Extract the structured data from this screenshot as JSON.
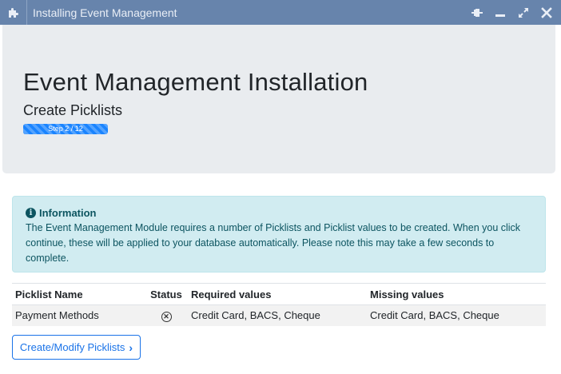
{
  "window": {
    "title": "Installing Event Management",
    "title_bar_color": "#6784ac",
    "icons": [
      "puzzle-icon",
      "pin-icon",
      "minimize-icon",
      "maximize-icon",
      "close-icon"
    ]
  },
  "header": {
    "title": "Event Management Installation",
    "subtitle": "Create Picklists",
    "progress": {
      "label": "Step 2 / 12",
      "current": 2,
      "total": 12,
      "color": "#1a84ff"
    }
  },
  "info": {
    "heading": "Information",
    "text": "The Event Management Module requires a number of Picklists and Picklist values to be created. When you click continue, these will be applied to your database automatically. Please note this may take a few seconds to complete."
  },
  "table": {
    "headers": [
      "Picklist Name",
      "Status",
      "Required values",
      "Missing values"
    ],
    "rows": [
      {
        "name": "Payment Methods",
        "status": "missing",
        "status_icon": "circle-x-icon",
        "required": "Credit Card, BACS, Cheque",
        "missing": "Credit Card, BACS, Cheque"
      }
    ]
  },
  "actions": {
    "create_button": "Create/Modify Picklists",
    "accent_color": "#1a73e8"
  }
}
